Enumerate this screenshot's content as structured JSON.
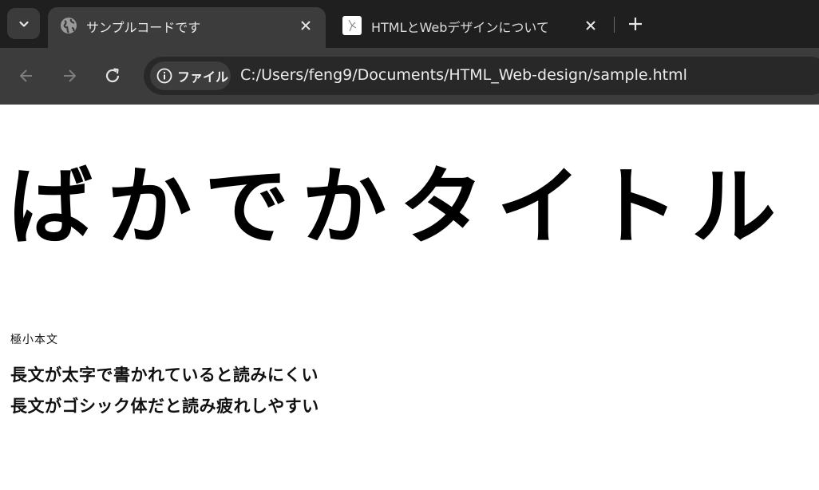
{
  "browser": {
    "tabs": [
      {
        "title": "サンプルコードです",
        "active": true,
        "favicon": "globe-icon"
      },
      {
        "title": "HTMLとWebデザインについて",
        "active": false,
        "favicon": "page-favicon-icon"
      }
    ],
    "toolbar": {
      "chip_label": "ファイル",
      "url": "C:/Users/feng9/Documents/HTML_Web-design/sample.html"
    }
  },
  "page": {
    "big_title": "ばかでかタイトル",
    "tiny_text": "極小本文",
    "lines": [
      "長文が太字で書かれていると読みにくい",
      "長文がゴシック体だと読み疲れしやすい"
    ]
  }
}
